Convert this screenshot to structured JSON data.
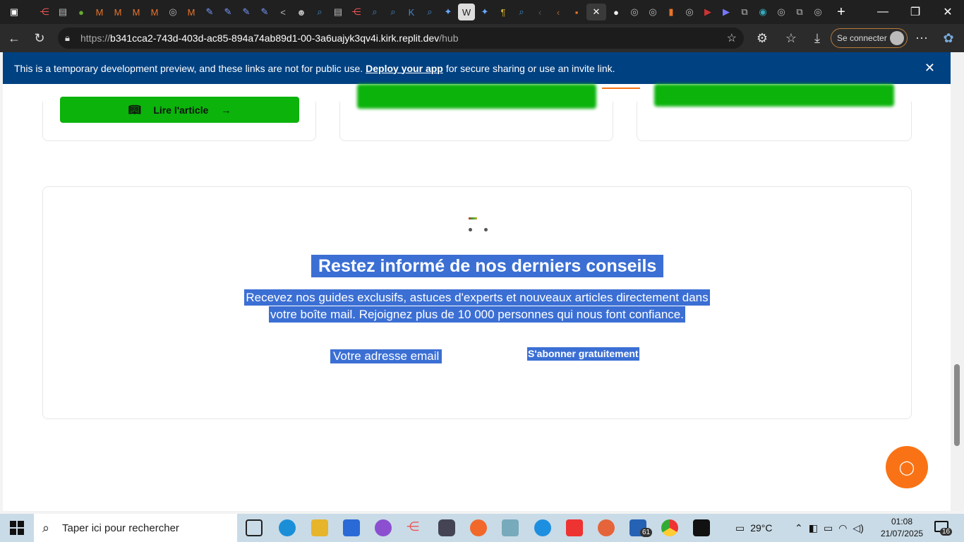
{
  "browser": {
    "url_prefix": "https://",
    "url_host": "b341cca2-743d-403d-ac85-894a74ab89d1-00-3a6uajyk3qv4i.kirk.replit.dev",
    "url_path": "/hub",
    "signin_label": "Se connecter"
  },
  "banner": {
    "text_before": "This is a temporary development preview, and these links are not for public use.",
    "link": "Deploy your app",
    "text_after": "for secure sharing or use an invite link."
  },
  "cards": {
    "first_button": "Lire l'article"
  },
  "newsletter": {
    "title": "Restez informé de nos derniers conseils",
    "desc_line1": "Recevez nos guides exclusifs, astuces d'experts et nouveaux articles directement dans",
    "desc_line2": "votre boîte mail. Rejoignez plus de 10 000 personnes qui nous font confiance.",
    "email_placeholder": "Votre adresse email",
    "subscribe_label": "S'abonner gratuitement"
  },
  "taskbar": {
    "search_placeholder": "Taper ici pour rechercher",
    "weather": "29°C",
    "time": "01:08",
    "date": "21/07/2025",
    "badge_count": "61",
    "notif_count": "16"
  },
  "colors": {
    "banner": "#004182",
    "green": "#0bb30b",
    "accent": "#f97316",
    "selection": "#3b6fd4"
  }
}
